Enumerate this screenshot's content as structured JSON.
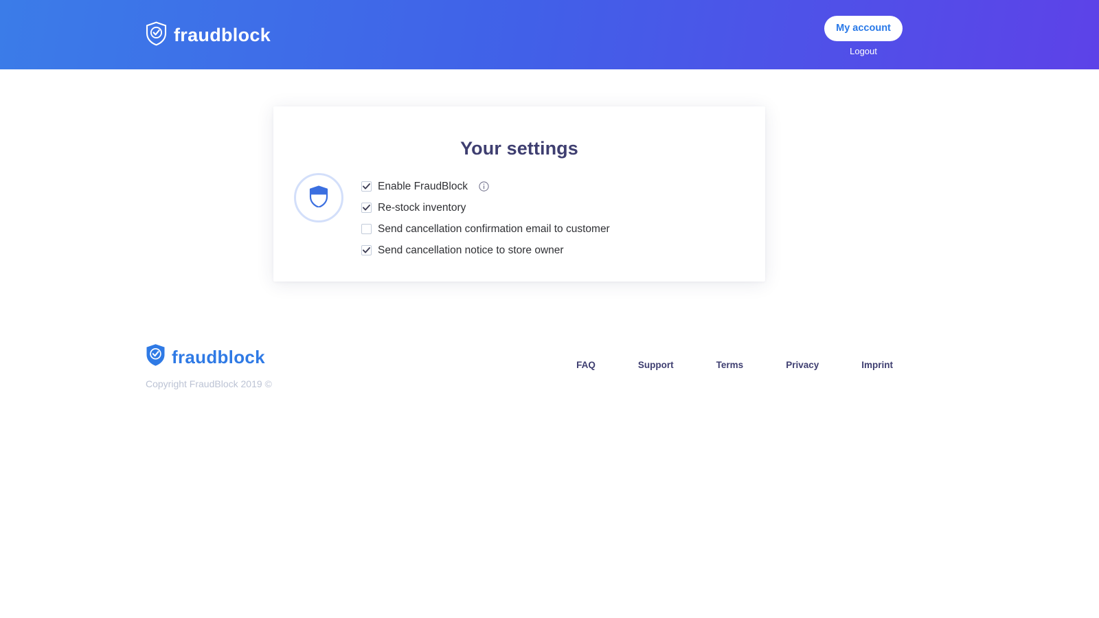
{
  "brand": {
    "name": "fraudblock",
    "accent_blue": "#2f7ae5",
    "header_gradient_from": "#3b7ce8",
    "header_gradient_to": "#5d42e8",
    "title_navy": "#3e3e70"
  },
  "header": {
    "logo_text": "fraudblock",
    "logo_icon": "shield-check-icon",
    "account_button": "My account",
    "logout_link": "Logout"
  },
  "main": {
    "card_title": "Your settings",
    "badge_icon": "shield-icon",
    "settings": [
      {
        "label": "Enable FraudBlock",
        "checked": true,
        "info_icon": "info-circle-icon"
      },
      {
        "label": "Re-stock inventory",
        "checked": true,
        "info_icon": null
      },
      {
        "label": "Send cancellation confirmation email to customer",
        "checked": false,
        "info_icon": null
      },
      {
        "label": "Send cancellation notice to store owner",
        "checked": true,
        "info_icon": null
      }
    ]
  },
  "footer": {
    "logo_text": "fraudblock",
    "logo_icon": "shield-check-icon",
    "copyright": "Copyright FraudBlock 2019 ©",
    "links": [
      {
        "label": "FAQ"
      },
      {
        "label": "Support"
      },
      {
        "label": "Terms"
      },
      {
        "label": "Privacy"
      },
      {
        "label": "Imprint"
      }
    ]
  }
}
